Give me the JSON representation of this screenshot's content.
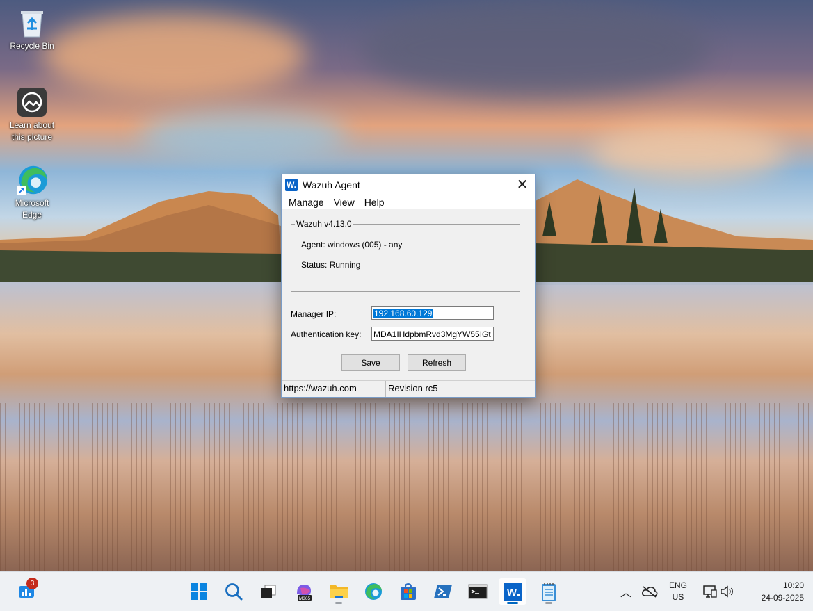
{
  "desktop": {
    "icons": [
      {
        "label": "Recycle Bin"
      },
      {
        "label": "Learn about this picture"
      },
      {
        "label": "Microsoft Edge"
      }
    ]
  },
  "window": {
    "title": "Wazuh Agent",
    "app_icon_text": "W.",
    "close_glyph": "✕",
    "menu": [
      "Manage",
      "View",
      "Help"
    ],
    "group_title": "Wazuh v4.13.0",
    "agent_line": "Agent: windows (005)  -  any",
    "status_line": "Status: Running",
    "manager_ip_label": "Manager IP:",
    "manager_ip_value": "192.168.60.129",
    "auth_key_label": "Authentication key:",
    "auth_key_value": "MDA1IHdpbmRvd3MgYW55IGt",
    "save_label": "Save",
    "refresh_label": "Refresh",
    "status_url": "https://wazuh.com",
    "status_revision": "Revision rc5"
  },
  "taskbar": {
    "widgets_badge": "3",
    "m365_label": "M365",
    "pinned": [
      "start-icon",
      "search-icon",
      "task-view-icon",
      "copilot-m365-icon",
      "file-explorer-icon",
      "edge-icon",
      "store-icon",
      "powershell-icon",
      "terminal-icon",
      "wazuh-agent-icon",
      "notepad-icon"
    ],
    "tray": {
      "lang": "ENG",
      "region": "US",
      "time": "10:20",
      "date": "24-09-2025"
    }
  },
  "colors": {
    "accent": "#0078d7",
    "wazuh_blue": "#0a64c8",
    "badge_red": "#c42b1c"
  }
}
